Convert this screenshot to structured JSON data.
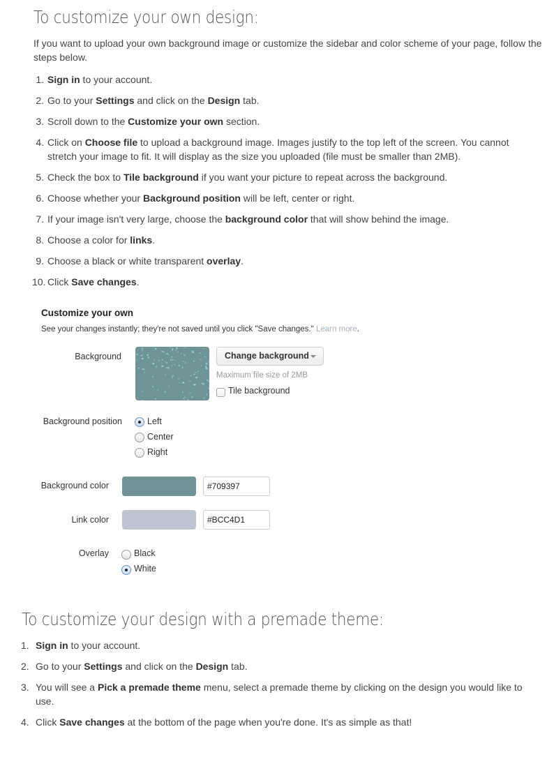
{
  "section1": {
    "heading": "To customize your own design:",
    "intro": "If you want to upload your own background image or customize the sidebar and color scheme of your page, follow the steps below.",
    "steps": [
      {
        "num": "1.",
        "parts": [
          {
            "b": "Sign in"
          },
          {
            "t": " to your account."
          }
        ]
      },
      {
        "num": "2.",
        "parts": [
          {
            "t": "Go to your "
          },
          {
            "b": "Settings"
          },
          {
            "t": " and click on the "
          },
          {
            "b": "Design"
          },
          {
            "t": " tab."
          }
        ]
      },
      {
        "num": "3.",
        "parts": [
          {
            "t": "Scroll down to the "
          },
          {
            "b": "Customize your own"
          },
          {
            "t": " section."
          }
        ]
      },
      {
        "num": "4.",
        "parts": [
          {
            "t": "Click on "
          },
          {
            "b": "Choose file"
          },
          {
            "t": " to upload a background image. Images justify to the top left of the screen. You cannot stretch your image to fit. It will display as the size you uploaded (file must be smaller than 2MB)."
          }
        ]
      },
      {
        "num": "5.",
        "parts": [
          {
            "t": "Check the box to "
          },
          {
            "b": "Tile background"
          },
          {
            "t": " if you want your picture to repeat across the background."
          }
        ]
      },
      {
        "num": "6.",
        "parts": [
          {
            "t": "Choose whether your "
          },
          {
            "b": "Background position"
          },
          {
            "t": " will be left, center or right."
          }
        ]
      },
      {
        "num": "7.",
        "parts": [
          {
            "t": "If your image isn't very large, choose the "
          },
          {
            "b": "background color"
          },
          {
            "t": " that will show behind the image."
          }
        ]
      },
      {
        "num": "8.",
        "parts": [
          {
            "t": "Choose a color for "
          },
          {
            "b": "links"
          },
          {
            "t": "."
          }
        ]
      },
      {
        "num": "9.",
        "parts": [
          {
            "t": "Choose a black or white transparent "
          },
          {
            "b": "overlay"
          },
          {
            "t": "."
          }
        ]
      },
      {
        "num": "10.",
        "parts": [
          {
            "t": "Click "
          },
          {
            "b": "Save changes"
          },
          {
            "t": "."
          }
        ]
      }
    ]
  },
  "panel": {
    "title": "Customize your own",
    "description": "See your changes instantly; they're not saved until you click \"Save changes.\"",
    "learn_more": "Learn more",
    "learn_more_suffix": ".",
    "background_label": "Background",
    "change_background_button": "Change background",
    "max_file_hint": "Maximum file size of 2MB",
    "tile_background_label": "Tile background",
    "tile_background_checked": false,
    "background_position_label": "Background position",
    "background_position_options": [
      "Left",
      "Center",
      "Right"
    ],
    "background_position_selected": "Left",
    "background_color_label": "Background color",
    "background_color_value": "#709397",
    "link_color_label": "Link color",
    "link_color_value": "#BCC4D1",
    "overlay_label": "Overlay",
    "overlay_options": [
      "Black",
      "White"
    ],
    "overlay_selected": "White",
    "thumbnail_color": "#6f9496",
    "thumbnail_speckle_color": "#a6d6d4"
  },
  "section2": {
    "heading": "To customize your design with a premade theme:",
    "steps": [
      {
        "num": "1.",
        "parts": [
          {
            "b": "Sign in"
          },
          {
            "t": " to your account."
          }
        ]
      },
      {
        "num": "2.",
        "parts": [
          {
            "t": "Go to your "
          },
          {
            "b": "Settings"
          },
          {
            "t": " and click on the "
          },
          {
            "b": "Design"
          },
          {
            "t": " tab."
          }
        ]
      },
      {
        "num": "3.",
        "parts": [
          {
            "t": "You will see a "
          },
          {
            "b": "Pick a premade theme"
          },
          {
            "t": " menu, select a premade theme by clicking on the design you would like to use."
          }
        ]
      },
      {
        "num": "4.",
        "parts": [
          {
            "t": "Click "
          },
          {
            "b": "Save changes"
          },
          {
            "t": " at the bottom of the page when you're done. It's as simple as that!"
          }
        ]
      }
    ]
  }
}
